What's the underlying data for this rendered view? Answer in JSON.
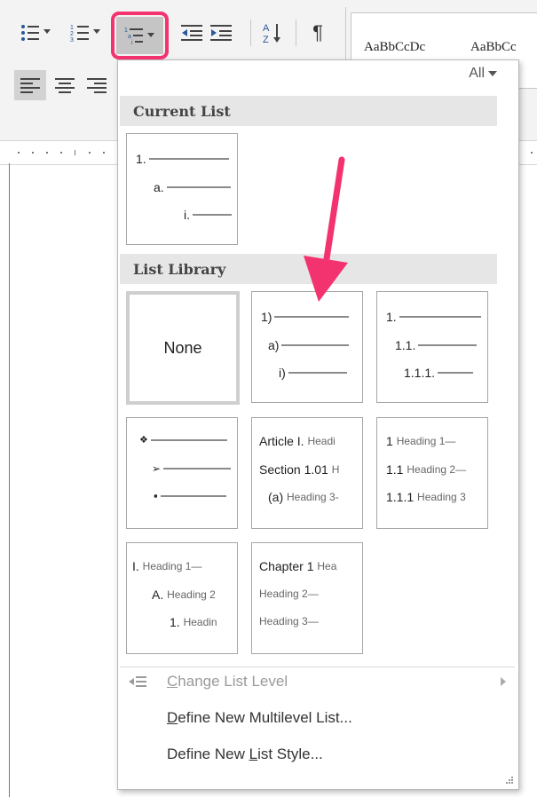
{
  "ribbon": {
    "styles": [
      "AaBbCcDc",
      "AaBbCc"
    ],
    "icons": [
      "bullets-icon",
      "numbering-icon",
      "multilevel-list-icon",
      "decrease-indent-icon",
      "increase-indent-icon",
      "sort-icon",
      "show-formatting-marks-icon",
      "align-left-icon",
      "center-icon",
      "align-right-icon"
    ]
  },
  "dropdown": {
    "filter": "All",
    "current_list_header": "Current List",
    "current_list": {
      "levels": [
        "1.",
        "a.",
        "i."
      ]
    },
    "library_header": "List Library",
    "library": {
      "none_label": "None",
      "tile2": [
        "1)",
        "a)",
        "i)"
      ],
      "tile3": [
        "1.",
        "1.1.",
        "1.1.1."
      ],
      "tile4": [
        "❖",
        "➢",
        "▪"
      ],
      "tile5": [
        {
          "num": "Article I.",
          "label": "Headi"
        },
        {
          "num": "Section 1.01",
          "label": "H"
        },
        {
          "num": "(a)",
          "label": "Heading 3-"
        }
      ],
      "tile6": [
        {
          "num": "1",
          "label": "Heading 1—"
        },
        {
          "num": "1.1",
          "label": "Heading 2—"
        },
        {
          "num": "1.1.1",
          "label": "Heading 3"
        }
      ],
      "tile7": [
        {
          "num": "I.",
          "label": "Heading 1—"
        },
        {
          "num": "A.",
          "label": "Heading 2"
        },
        {
          "num": "1.",
          "label": "Headin"
        }
      ],
      "tile8": [
        {
          "num": "Chapter 1",
          "label": "Hea"
        },
        {
          "num": "",
          "label": "Heading 2—"
        },
        {
          "num": "",
          "label": "Heading 3—"
        }
      ]
    },
    "menu": {
      "change_level": {
        "before": "",
        "u": "C",
        "after": "hange List Level"
      },
      "define_list": {
        "before": "",
        "u": "D",
        "after": "efine New Multilevel List..."
      },
      "define_style": {
        "before": "Define New ",
        "u": "L",
        "after": "ist Style..."
      }
    }
  },
  "colors": {
    "annotation": "#f2336f",
    "section_header_bg": "#e6e6e6"
  }
}
